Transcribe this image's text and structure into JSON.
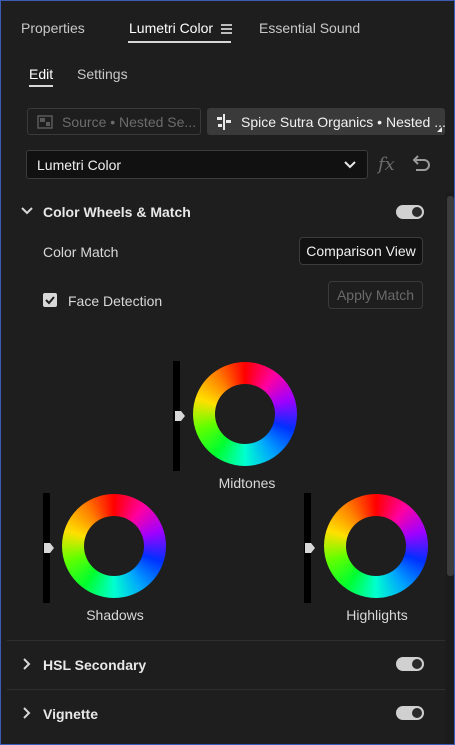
{
  "tabs": [
    {
      "label": "Properties"
    },
    {
      "label": "Lumetri Color"
    },
    {
      "label": "Essential Sound"
    }
  ],
  "subtabs": [
    {
      "label": "Edit"
    },
    {
      "label": "Settings"
    }
  ],
  "clip_selector": {
    "source_label": "Source • Nested Se...",
    "sequence_label": "Spice Sutra Organics • Nested ..."
  },
  "effect_dropdown": {
    "selected": "Lumetri Color"
  },
  "sections": {
    "color_wheels": {
      "title": "Color Wheels & Match",
      "enabled": true,
      "color_match_label": "Color Match",
      "comparison_view_button": "Comparison View",
      "face_detection_label": "Face Detection",
      "face_detection_checked": true,
      "apply_match_button": "Apply Match",
      "wheels": {
        "midtones": "Midtones",
        "shadows": "Shadows",
        "highlights": "Highlights"
      }
    },
    "hsl_secondary": {
      "title": "HSL Secondary",
      "enabled": true
    },
    "vignette": {
      "title": "Vignette",
      "enabled": true
    }
  },
  "icons": {
    "fx": "fx",
    "reset": "reset-icon",
    "menu": "hamburger-menu-icon"
  },
  "colors": {
    "panel_bg": "#1e1e1e",
    "focus_border": "#3b5bb5"
  }
}
